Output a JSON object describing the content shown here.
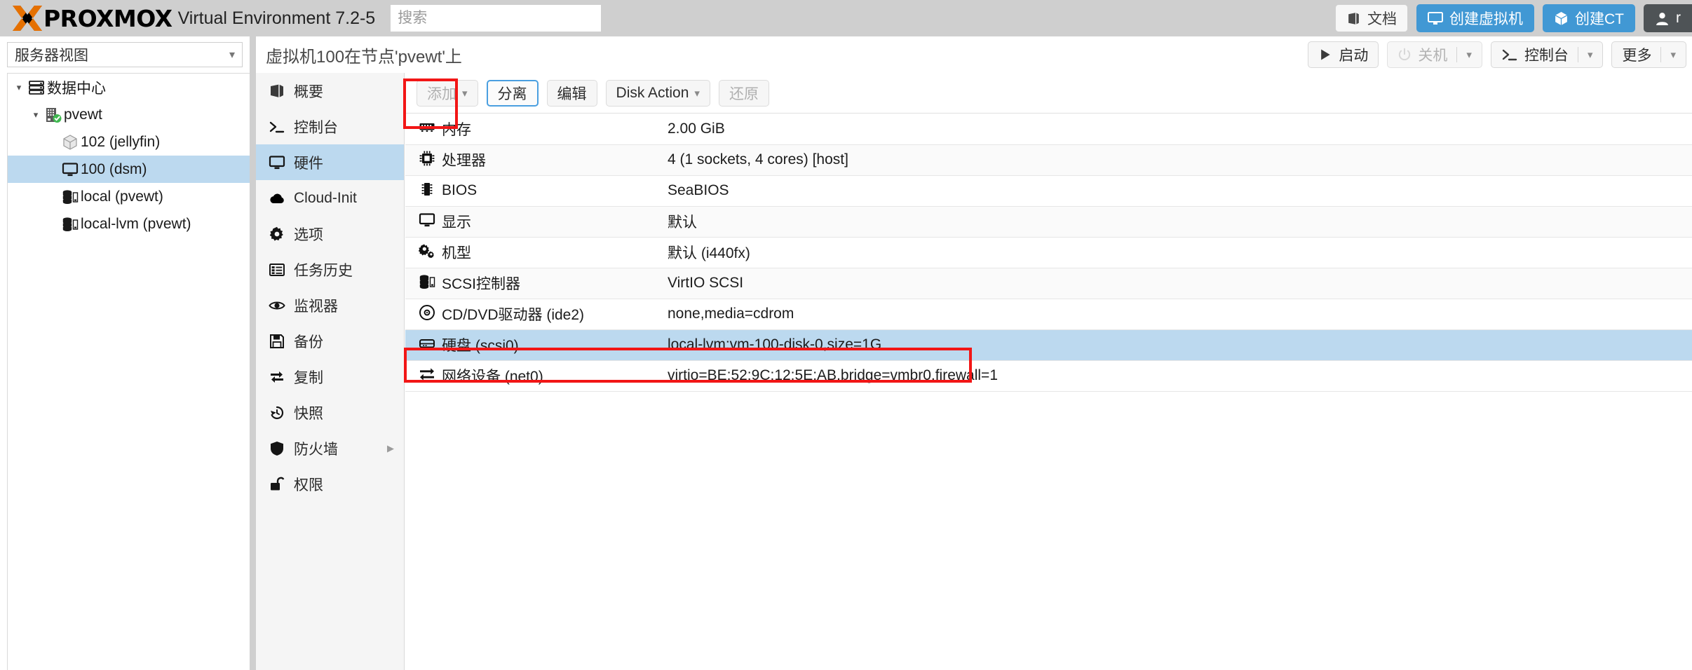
{
  "topbar": {
    "logo_text": "PROXMOX",
    "product": "Virtual Environment 7.2-5",
    "search_placeholder": "搜索",
    "search_value": "",
    "buttons": [
      {
        "label": "文档",
        "icon": "book-icon",
        "style": "light"
      },
      {
        "label": "创建虚拟机",
        "icon": "monitor-icon",
        "style": "blue"
      },
      {
        "label": "创建CT",
        "icon": "cube-icon",
        "style": "blue"
      },
      {
        "label": "r",
        "icon": "user-icon",
        "style": "dark"
      }
    ]
  },
  "sidebar": {
    "view_selector": "服务器视图",
    "tree": [
      {
        "label": "数据中心",
        "icon": "datacenter-icon",
        "indent": 0,
        "arrow": "v",
        "selected": false
      },
      {
        "label": "pvewt",
        "icon": "node-icon",
        "indent": 1,
        "arrow": "v",
        "selected": false
      },
      {
        "label": "102 (jellyfin)",
        "icon": "cube-icon",
        "indent": 2,
        "arrow": "",
        "selected": false
      },
      {
        "label": "100 (dsm)",
        "icon": "monitor-icon",
        "indent": 2,
        "arrow": "",
        "selected": true
      },
      {
        "label": "local (pvewt)",
        "icon": "storage-icon",
        "indent": 2,
        "arrow": "",
        "selected": false
      },
      {
        "label": "local-lvm (pvewt)",
        "icon": "storage-icon",
        "indent": 2,
        "arrow": "",
        "selected": false
      }
    ]
  },
  "header": {
    "title": "虚拟机100在节点'pvewt'上",
    "actions": [
      {
        "label": "启动",
        "icon": "play-icon",
        "disabled": false,
        "dropdown": false
      },
      {
        "label": "关机",
        "icon": "power-icon",
        "disabled": true,
        "dropdown": true
      },
      {
        "label": "控制台",
        "icon": "terminal-icon",
        "disabled": false,
        "dropdown": true
      },
      {
        "label": "更多",
        "icon": "",
        "disabled": false,
        "dropdown": true
      }
    ]
  },
  "nav": {
    "items": [
      {
        "label": "概要",
        "icon": "book-icon",
        "active": false,
        "expand": false
      },
      {
        "label": "控制台",
        "icon": "terminal-icon",
        "active": false,
        "expand": false
      },
      {
        "label": "硬件",
        "icon": "monitor-icon",
        "active": true,
        "expand": false
      },
      {
        "label": "Cloud-Init",
        "icon": "cloud-icon",
        "active": false,
        "expand": false
      },
      {
        "label": "选项",
        "icon": "gear-icon",
        "active": false,
        "expand": false
      },
      {
        "label": "任务历史",
        "icon": "list-icon",
        "active": false,
        "expand": false
      },
      {
        "label": "监视器",
        "icon": "eye-icon",
        "active": false,
        "expand": false
      },
      {
        "label": "备份",
        "icon": "save-icon",
        "active": false,
        "expand": false
      },
      {
        "label": "复制",
        "icon": "replicate-icon",
        "active": false,
        "expand": false
      },
      {
        "label": "快照",
        "icon": "history-icon",
        "active": false,
        "expand": false
      },
      {
        "label": "防火墙",
        "icon": "shield-icon",
        "active": false,
        "expand": true
      },
      {
        "label": "权限",
        "icon": "unlock-icon",
        "active": false,
        "expand": false
      }
    ]
  },
  "toolbar": {
    "buttons": [
      {
        "label": "添加",
        "dropdown": true,
        "disabled": true,
        "focused": false
      },
      {
        "label": "分离",
        "dropdown": false,
        "disabled": false,
        "focused": true
      },
      {
        "label": "编辑",
        "dropdown": false,
        "disabled": false,
        "focused": false
      },
      {
        "label": "Disk Action",
        "dropdown": true,
        "disabled": false,
        "focused": false
      },
      {
        "label": "还原",
        "dropdown": false,
        "disabled": true,
        "focused": false
      }
    ]
  },
  "hardware": {
    "rows": [
      {
        "icon": "memory-icon",
        "key": "内存",
        "value": "2.00 GiB",
        "selected": false
      },
      {
        "icon": "cpu-icon",
        "key": "处理器",
        "value": "4 (1 sockets, 4 cores) [host]",
        "selected": false
      },
      {
        "icon": "chip-icon",
        "key": "BIOS",
        "value": "SeaBIOS",
        "selected": false
      },
      {
        "icon": "monitor-icon",
        "key": "显示",
        "value": "默认",
        "selected": false
      },
      {
        "icon": "gears-icon",
        "key": "机型",
        "value": "默认 (i440fx)",
        "selected": false
      },
      {
        "icon": "storage-icon",
        "key": "SCSI控制器",
        "value": "VirtIO SCSI",
        "selected": false
      },
      {
        "icon": "cd-icon",
        "key": "CD/DVD驱动器 (ide2)",
        "value": "none,media=cdrom",
        "selected": false
      },
      {
        "icon": "harddisk-icon",
        "key": "硬盘 (scsi0)",
        "value": "local-lvm:vm-100-disk-0,size=1G",
        "selected": true
      },
      {
        "icon": "network-icon",
        "key": "网络设备 (net0)",
        "value": "virtio=BE:52:9C:12:5E:AB,bridge=vmbr0,firewall=1",
        "selected": false
      }
    ]
  },
  "annotations": {
    "colors": {
      "highlight": "#f21616",
      "selection": "#bcd9ef",
      "accent": "#4198d4",
      "topbar": "#cfcfcf"
    }
  }
}
